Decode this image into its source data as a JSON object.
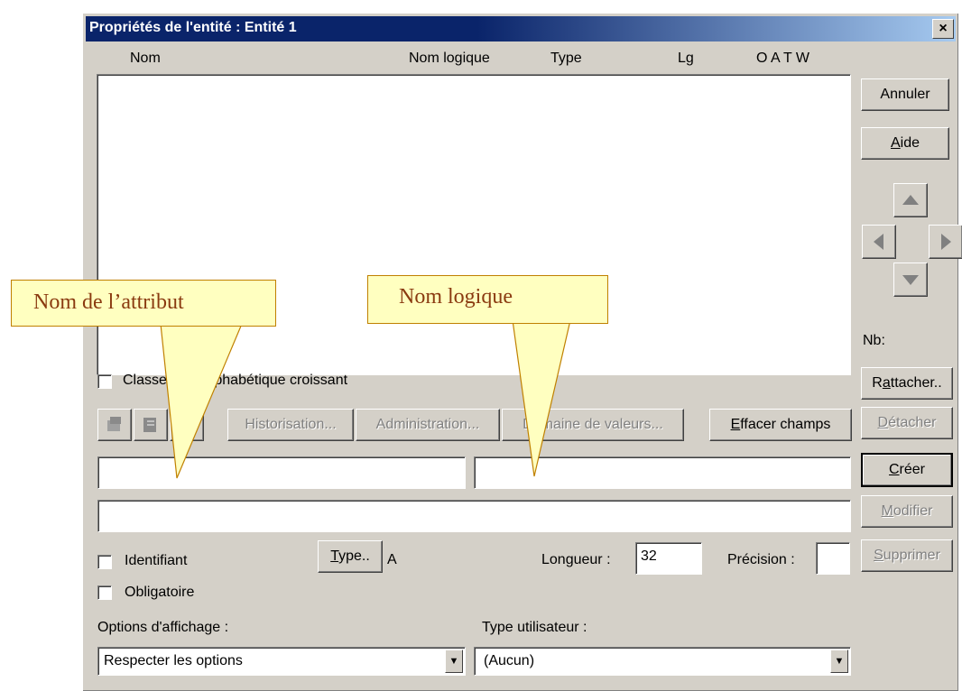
{
  "dialog": {
    "title": "Propriétés de l'entité : Entité 1",
    "close_label": "×"
  },
  "list": {
    "columns": [
      "Nom",
      "Nom logique",
      "Type",
      "Lg",
      "O A T W"
    ]
  },
  "side": {
    "annuler": "Annuler",
    "aide_first": "A",
    "aide_rest": "ide",
    "nb_label": "Nb:",
    "rattacher_pre": "R",
    "rattacher_u": "a",
    "rattacher_rest": "ttacher..",
    "detacher_first": "D",
    "detacher_rest": "étacher",
    "creer_first": "C",
    "creer_rest": "réer",
    "modifier_first": "M",
    "modifier_rest": "odifier",
    "supprimer_first": "S",
    "supprimer_rest": "upprimer"
  },
  "sort_checkbox_label": "Classement alphabétique croissant",
  "toolbar": {
    "historisation": "Historisation...",
    "administration": "Administration...",
    "domaine": "Domaine de valeurs...",
    "effacer_first": "E",
    "effacer_rest": "ffacer champs"
  },
  "fields": {
    "nom_value": "",
    "nom_logique_value": "",
    "comment_value": ""
  },
  "attrs": {
    "identifiant": "Identifiant",
    "obligatoire": "Obligatoire",
    "type_btn_first": "T",
    "type_btn_rest": "ype..",
    "type_value": "A",
    "longueur_label": "Longueur :",
    "longueur_value": "32",
    "precision_label": "Précision :",
    "precision_value": ""
  },
  "options": {
    "affichage_label": "Options d'affichage :",
    "affichage_value": "Respecter les options",
    "type_utilisateur_label": "Type utilisateur :",
    "type_utilisateur_value": "(Aucun)"
  },
  "callouts": {
    "left": "Nom de l’attribut",
    "right": "Nom logique"
  }
}
